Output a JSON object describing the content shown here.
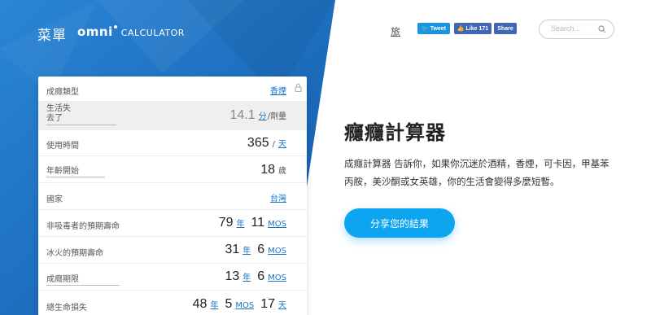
{
  "header": {
    "menu_label": "菜單",
    "logo_omni": "omni",
    "logo_calculator": "CALCULATOR",
    "lang_link": "旅",
    "tweet_label": "Tweet",
    "like_label": "Like 171",
    "share_label": "Share",
    "search_placeholder": "Search..."
  },
  "calculator": {
    "rows": [
      {
        "label": "成癮類型",
        "unit": "香煙"
      },
      {
        "label_line1": "生活失",
        "label_line2": "去了",
        "value": "14.1",
        "unit_link": "分",
        "unit_suffix": "/劑量"
      },
      {
        "label": "使用時間",
        "value": "365",
        "unit_prefix": "/",
        "unit_link": "天"
      },
      {
        "label": "年齡開始",
        "value": "18",
        "unit_static": "歲"
      },
      {
        "label": "國家",
        "unit": "台灣"
      },
      {
        "label": "非吸毒者的預期壽命",
        "value1": "79",
        "unit1": "年",
        "value2": "11",
        "unit2": "MOS"
      },
      {
        "label": "冰火的預期壽命",
        "value1": "31",
        "unit1": "年",
        "value2": "6",
        "unit2": "MOS"
      },
      {
        "label": "成癮期限",
        "value1": "13",
        "unit1": "年",
        "value2": "6",
        "unit2": "MOS"
      },
      {
        "label": "總生命損失",
        "value1": "48",
        "unit1": "年",
        "value2": "5",
        "unit2": "MOS",
        "value3": "17",
        "unit3": "天"
      }
    ]
  },
  "main": {
    "title": "癮癮計算器",
    "description": "成癮計算器 告訴你，如果你沉迷於酒精，香煙，可卡因，甲基苯丙胺，美沙酮或女英雄，你的生活會變得多麼短暫。",
    "share_button": "分享您的結果"
  },
  "colors": {
    "hero_blue": "#1a6fc0",
    "accent": "#0ea5f0",
    "link": "#1a73c8"
  }
}
